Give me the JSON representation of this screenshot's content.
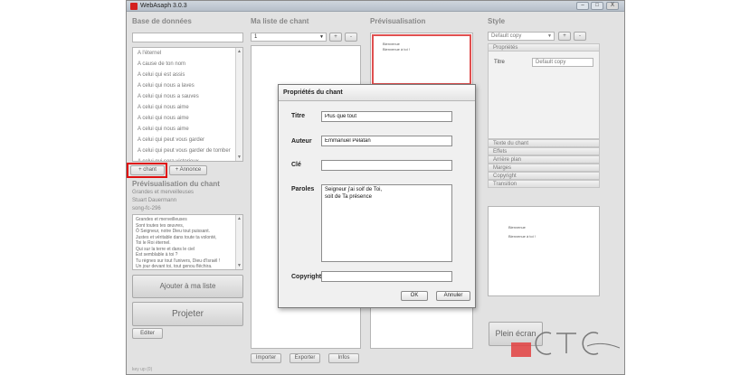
{
  "window": {
    "title": "WebAsaph 3.0.3",
    "minimize": "–",
    "maximize": "□",
    "close": "X"
  },
  "database": {
    "title": "Base de données",
    "search_value": "",
    "songs": [
      "A l'éternel",
      "A cause de ton nom",
      "A celui qui est assis",
      "A celui qui nous a laves",
      "A celui qui nous a sauves",
      "A celui qui nous aime",
      "A celui qui nous aime",
      "A celui qui nous aime",
      "A celui qui peut vous garder",
      "A celui qui peut vous garder de tomber",
      "A celui qui sera victorieux"
    ],
    "add_song": "+ chant",
    "add_announce": "+ Annonce"
  },
  "preview_song": {
    "title": "Prévisualisation du chant",
    "song_title": "Grandes et merveilleuses",
    "author": "Stuart Dauermann",
    "ref": "song-fc-296",
    "lyrics": [
      "Grandes et merveilleuses",
      "Sont toutes tes œuvres,",
      "Ô Seigneur, notre Dieu tout puissant.",
      "Justes et véritable dans toute ta volonté,",
      "Toi le Roi éternel.",
      "Qui sur la terre et dans le ciel",
      "Est semblable à toi ?",
      "Tu règnes sur tout l'univers, Dieu d'Israël !",
      "Un jour devant toi, tout genou fléchira."
    ],
    "add_to_list": "Ajouter à ma liste",
    "project": "Projeter",
    "edit": "Editer"
  },
  "my_list": {
    "title": "Ma liste de chant",
    "selected": "1",
    "import": "Importer",
    "export": "Exporter",
    "infos": "Infos"
  },
  "preview": {
    "title": "Prévisualisation",
    "line1": "Bienvenue",
    "line2": "Bienvenue à toi !"
  },
  "style": {
    "title": "Style",
    "selected": "Default copy",
    "properties_header": "Propriétés",
    "title_label": "Titre",
    "title_value": "Default copy",
    "sections": [
      "Texte du chant",
      "Effets",
      "Arrière plan",
      "Marges",
      "Copyright",
      "Transition"
    ],
    "preview_line1": "Bienvenue",
    "preview_line2": "Bienvenue à toi !",
    "fullscreen": "Plein écran"
  },
  "dialog": {
    "title": "Propriétés du chant",
    "title_label": "Titre",
    "title_value": "Plus que tout",
    "author_label": "Auteur",
    "author_value": "Emmanuel Pelatan",
    "key_label": "Clé",
    "key_value": "",
    "lyrics_label": "Paroles",
    "lyrics_value": "Seigneur j'ai soif de Toi,\nsoit de Ta présence",
    "copyright_label": "Copyright",
    "copyright_value": "",
    "ok": "OK",
    "cancel": "Annuler"
  },
  "statusbar": {
    "text": "key up (0)"
  },
  "colors": {
    "accent_red": "#d42020",
    "highlight_red": "#e01010"
  }
}
